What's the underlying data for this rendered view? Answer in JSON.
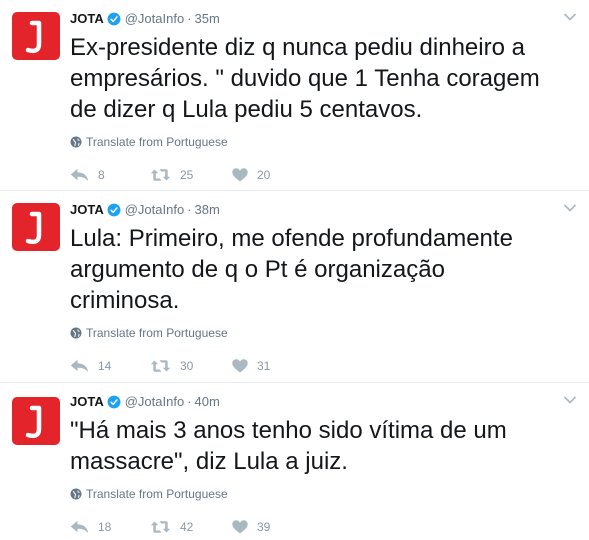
{
  "colors": {
    "brand_red": "#e3242b",
    "verified_blue": "#1da1f2",
    "meta_gray": "#657786",
    "action_gray": "#aab8c2"
  },
  "icons": {
    "verified": "verified-badge-icon",
    "caret": "chevron-down-icon",
    "globe": "globe-icon",
    "reply": "reply-icon",
    "retweet": "retweet-icon",
    "like": "heart-icon"
  },
  "tweets": [
    {
      "name": "JOTA",
      "handle": "@JotaInfo",
      "separator": "·",
      "time": "35m",
      "text": "Ex-presidente diz q nunca pediu dinheiro a empresários. \" duvido que 1 Tenha coragem de dizer q Lula pediu 5 centavos.",
      "translate": "Translate from Portuguese",
      "replies": "8",
      "retweets": "25",
      "likes": "20"
    },
    {
      "name": "JOTA",
      "handle": "@JotaInfo",
      "separator": "·",
      "time": "38m",
      "text": "Lula: Primeiro, me ofende profundamente argumento de q o Pt é organização criminosa.",
      "translate": "Translate from Portuguese",
      "replies": "14",
      "retweets": "30",
      "likes": "31"
    },
    {
      "name": "JOTA",
      "handle": "@JotaInfo",
      "separator": "·",
      "time": "40m",
      "text": "\"Há mais 3 anos tenho sido vítima de um massacre\", diz Lula a juiz.",
      "translate": "Translate from Portuguese",
      "replies": "18",
      "retweets": "42",
      "likes": "39"
    }
  ]
}
